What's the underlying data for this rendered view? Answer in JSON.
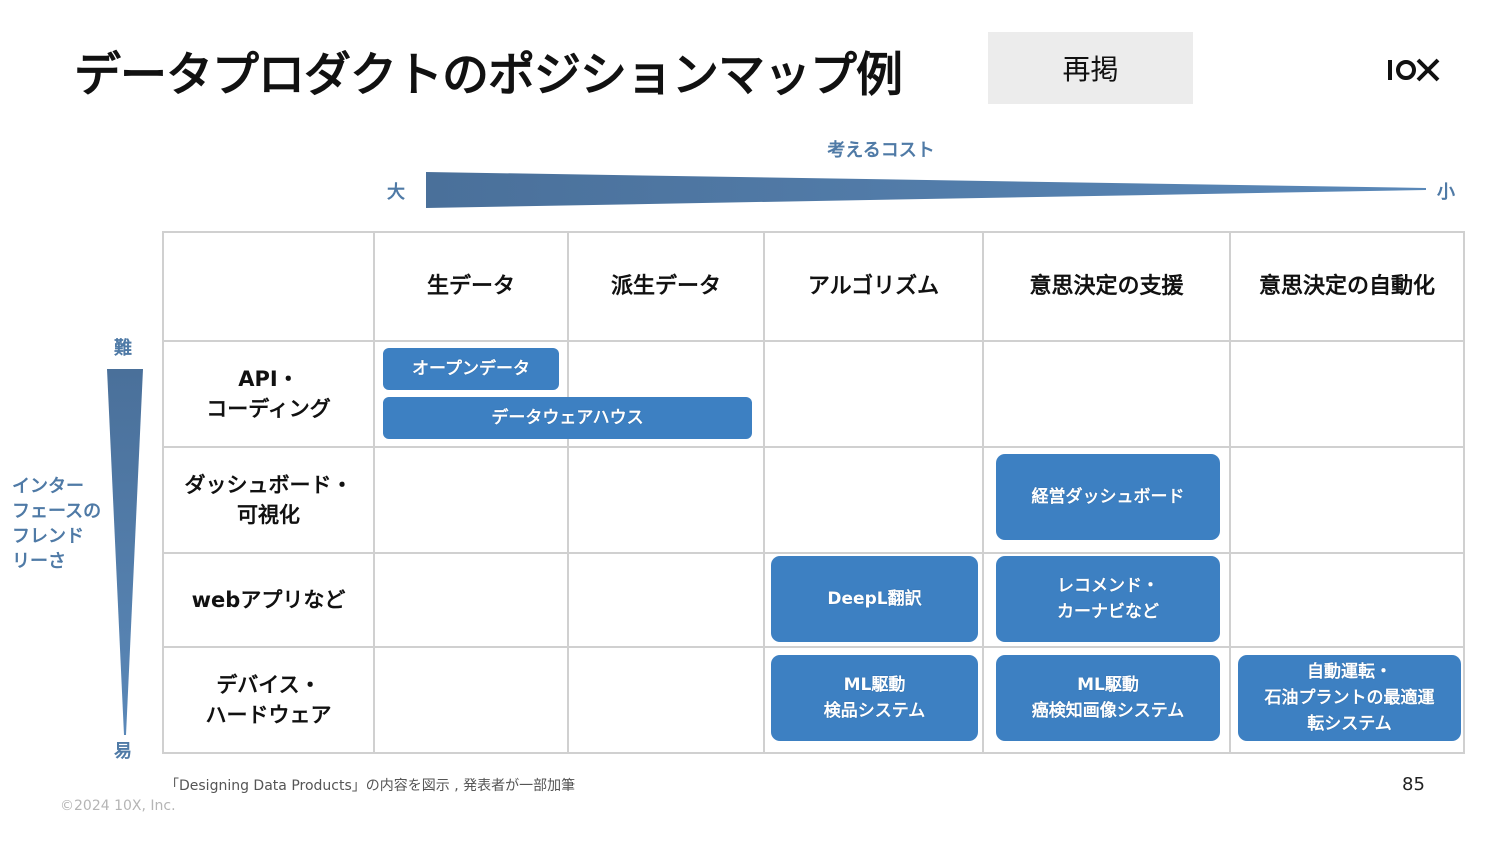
{
  "title": "データプロダクトのポジションマップ例",
  "badge": "再掲",
  "logo_text": "10X",
  "cost_axis": {
    "title": "考えるコスト",
    "left": "大",
    "right": "小"
  },
  "difficulty_axis": {
    "top": "難",
    "bottom": "易",
    "label": "インター\nフェースの\nフレンド\nリーさ"
  },
  "columns": [
    "生データ",
    "派生データ",
    "アルゴリズム",
    "意思決定の支援",
    "意思決定の自動化"
  ],
  "rows": [
    "API・\nコーディング",
    "ダッシュボード・\n可視化",
    "webアプリなど",
    "デバイス・\nハードウェア"
  ],
  "products": [
    {
      "label": "オープンデータ",
      "row": "API・コーディング",
      "columns": [
        "生データ"
      ]
    },
    {
      "label": "データウェアハウス",
      "row": "API・コーディング",
      "columns": [
        "生データ",
        "派生データ"
      ]
    },
    {
      "label": "経営ダッシュボード",
      "row": "ダッシュボード・可視化",
      "columns": [
        "意思決定の支援"
      ]
    },
    {
      "label": "DeepL翻訳",
      "row": "webアプリなど",
      "columns": [
        "アルゴリズム"
      ]
    },
    {
      "label": "レコメンド・\nカーナビなど",
      "row": "webアプリなど",
      "columns": [
        "意思決定の支援"
      ]
    },
    {
      "label": "ML駆動\n検品システム",
      "row": "デバイス・ハードウェア",
      "columns": [
        "アルゴリズム"
      ]
    },
    {
      "label": "ML駆動\n癌検知画像システム",
      "row": "デバイス・ハードウェア",
      "columns": [
        "意思決定の支援"
      ]
    },
    {
      "label": "自動運転・\n石油プラントの最適運\n転システム",
      "row": "デバイス・ハードウェア",
      "columns": [
        "意思決定の自動化"
      ]
    }
  ],
  "footer": {
    "source": "「Designing Data Products」の内容を図示 , 発表者が一部加筆",
    "copyright": "©2024 10X, Inc.",
    "page": "85"
  },
  "colors": {
    "accent_box": "#3d80c2",
    "axis_arrow": "#4f7aa6",
    "grid_line": "#d0d0d0"
  }
}
